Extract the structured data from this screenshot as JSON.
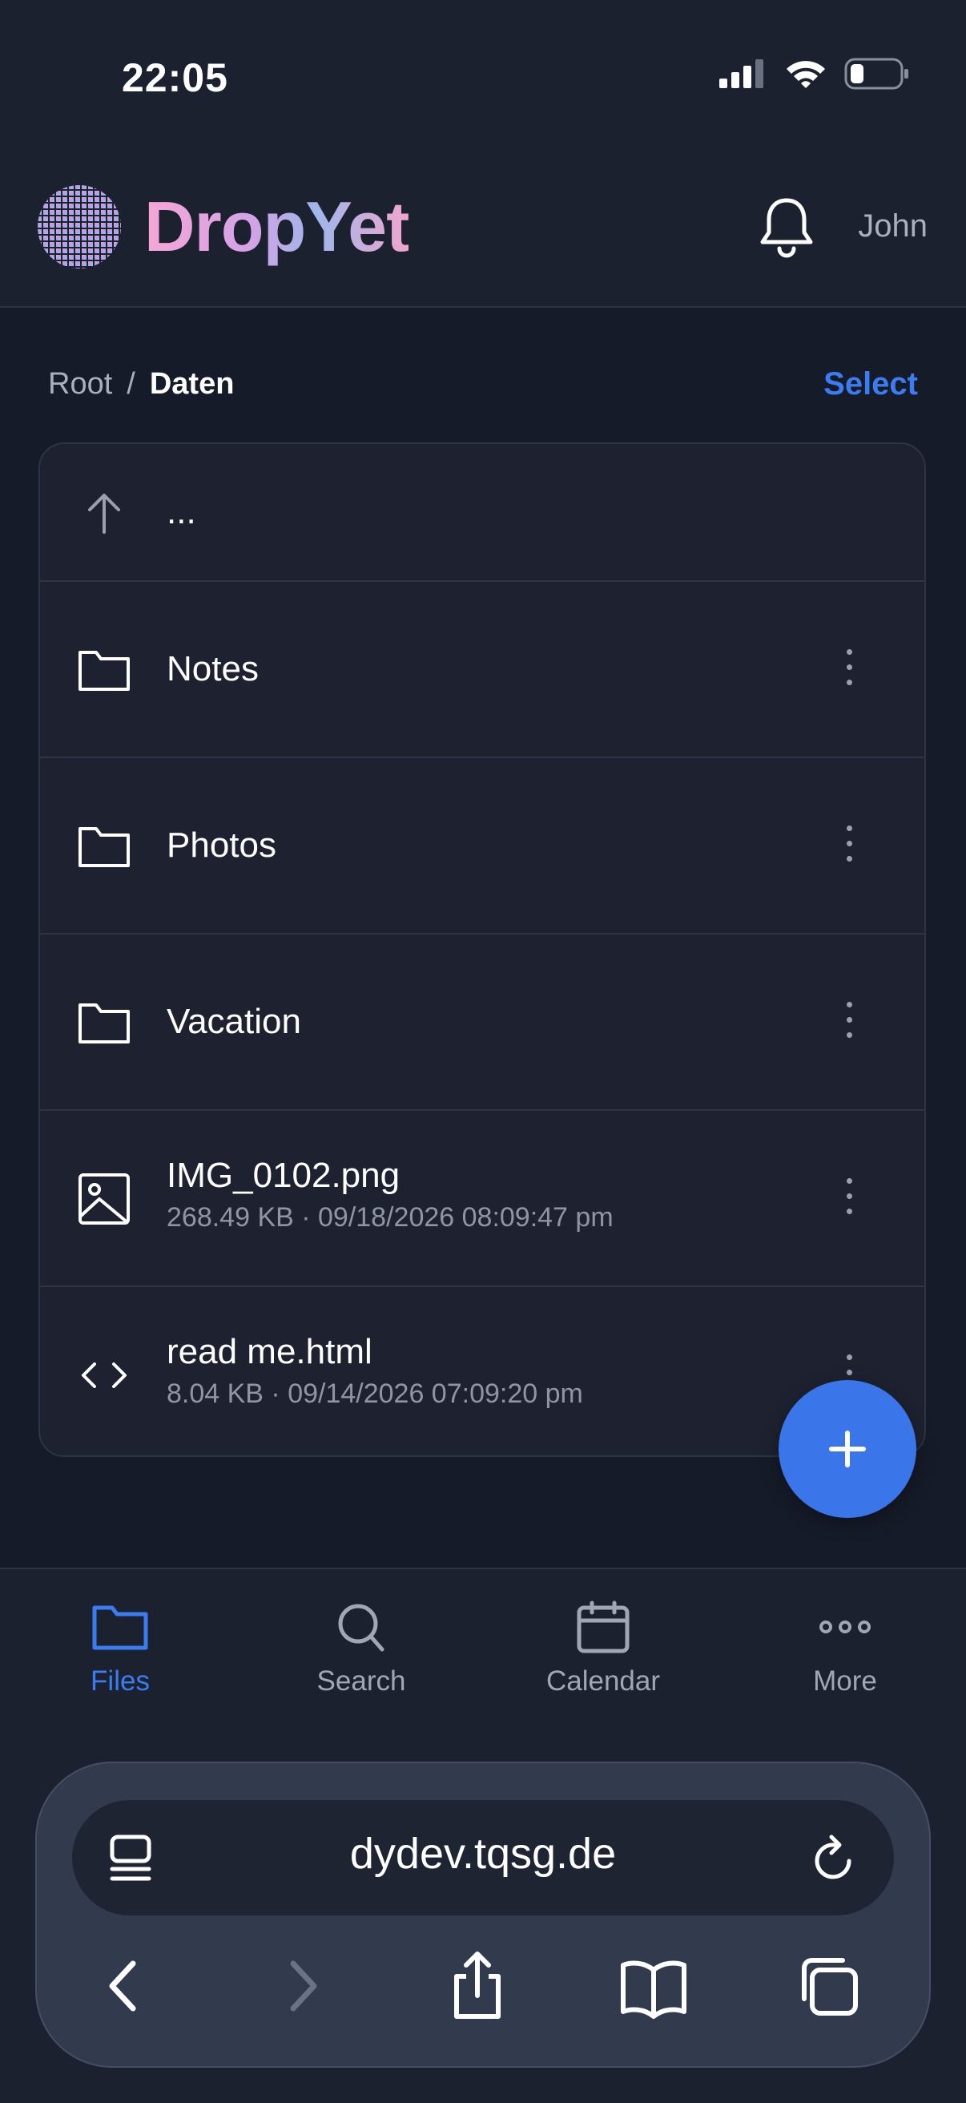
{
  "status": {
    "time": "22:05"
  },
  "header": {
    "app_name": "DropYet",
    "user": "John"
  },
  "breadcrumb": {
    "root": "Root",
    "separator": "/",
    "current": "Daten",
    "select_label": "Select"
  },
  "files": {
    "up_label": "...",
    "items": [
      {
        "name": "Notes",
        "type": "folder"
      },
      {
        "name": "Photos",
        "type": "folder"
      },
      {
        "name": "Vacation",
        "type": "folder"
      },
      {
        "name": "IMG_0102.png",
        "type": "image",
        "meta": "268.49 KB · 09/18/2026 08:09:47 pm"
      },
      {
        "name": "read me.html",
        "type": "code",
        "meta": "8.04 KB · 09/14/2026 07:09:20 pm"
      }
    ]
  },
  "tabs": [
    {
      "label": "Files",
      "icon": "folder-icon",
      "active": true
    },
    {
      "label": "Search",
      "icon": "search-icon",
      "active": false
    },
    {
      "label": "Calendar",
      "icon": "calendar-icon",
      "active": false
    },
    {
      "label": "More",
      "icon": "more-icon",
      "active": false
    }
  ],
  "browser": {
    "url": "dydev.tqsg.de"
  },
  "colors": {
    "accent": "#3b7cf0",
    "background": "#161b29",
    "surface": "#1e2230"
  }
}
